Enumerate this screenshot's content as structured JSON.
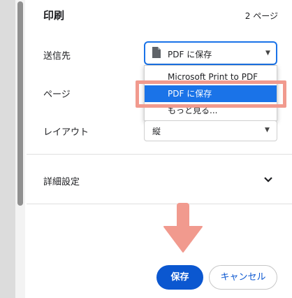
{
  "header": {
    "title": "印刷",
    "page_count": "2 ページ"
  },
  "destination": {
    "label": "送信先",
    "selected": "PDF に保存",
    "icon": "document-icon",
    "options": [
      "Microsoft Print to PDF",
      "PDF に保存",
      "もっと見る..."
    ],
    "highlighted_option": "PDF に保存"
  },
  "pages": {
    "label": "ページ"
  },
  "layout": {
    "label": "レイアウト",
    "selected": "縦"
  },
  "advanced": {
    "label": "詳細設定",
    "icon": "chevron-down-icon"
  },
  "actions": {
    "save_label": "保存",
    "cancel_label": "キャンセル"
  },
  "colors": {
    "accent": "#1a73e8",
    "primary_button": "#0b57d0",
    "annotation": "#f19a8e"
  }
}
